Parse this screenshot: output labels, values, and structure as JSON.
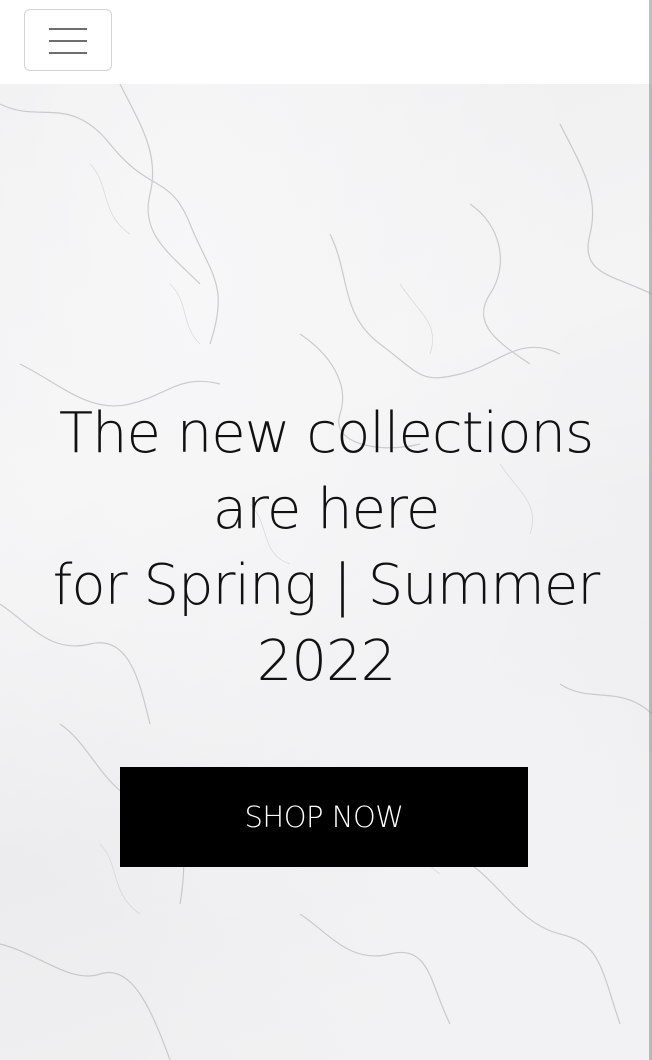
{
  "navbar": {
    "toggle_icon": "hamburger-menu-icon"
  },
  "hero": {
    "background": "marble-texture",
    "headline_lines": [
      "The new collections",
      "are here",
      "for Spring | Summer",
      "2022"
    ],
    "cta_label": "SHOP NOW"
  },
  "colors": {
    "cta_background": "#000000",
    "cta_text": "#ffffff",
    "headline_text": "#111111"
  }
}
